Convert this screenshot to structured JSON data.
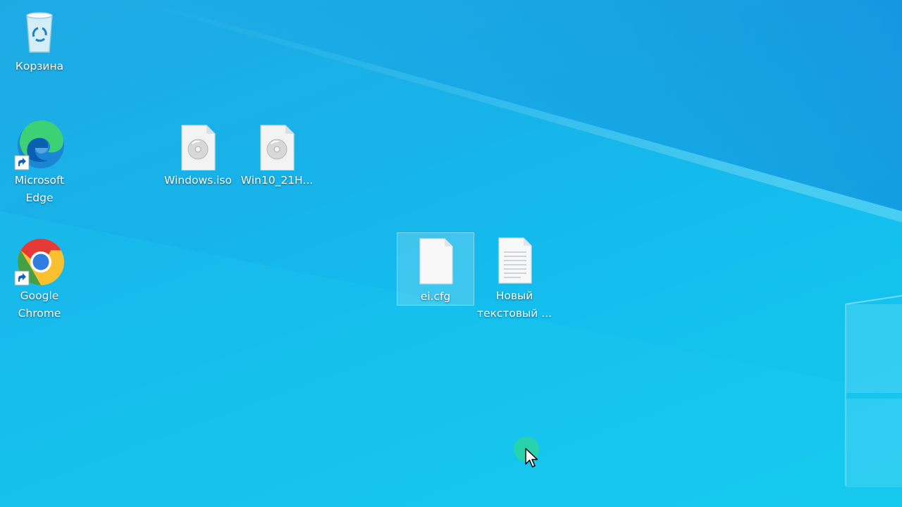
{
  "desktop": {
    "icons": [
      {
        "label": "Корзина",
        "icon": "recycle-bin-icon"
      },
      {
        "label": "Microsoft\nEdge",
        "icon": "microsoft-edge-icon"
      },
      {
        "label": "Google\nChrome",
        "icon": "google-chrome-icon"
      },
      {
        "label": "Windows.iso",
        "icon": "iso-file-icon"
      },
      {
        "label": "Win10_21H...",
        "icon": "iso-file-icon"
      },
      {
        "label": "ei.cfg",
        "icon": "blank-file-icon"
      },
      {
        "label": "Новый\nтекстовый ...",
        "icon": "text-file-icon"
      }
    ]
  },
  "colors": {
    "wallpaper_top": "#1fa9e3",
    "wallpaper_bottom": "#17c9ef",
    "click_indicator": "#2ed696"
  }
}
